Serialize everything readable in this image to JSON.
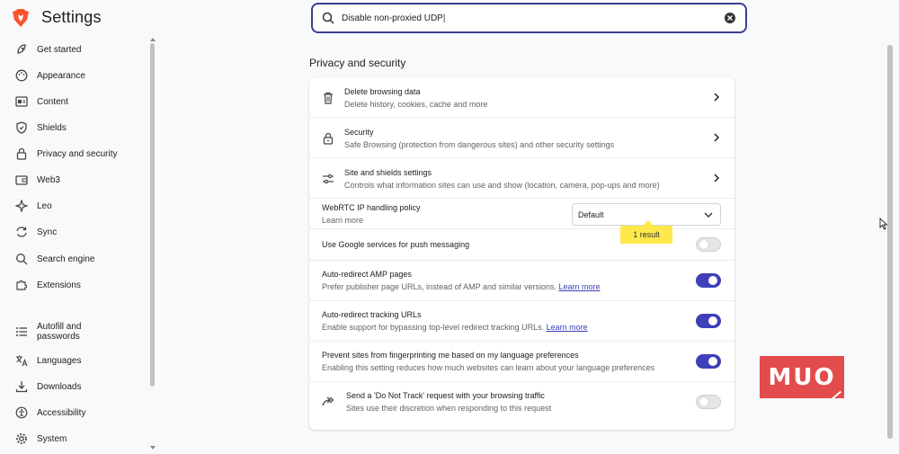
{
  "header": {
    "title": "Settings"
  },
  "search": {
    "value": "Disable non-proxied UDP"
  },
  "sidebar": {
    "items": [
      {
        "label": "Get started",
        "icon": "rocket-icon"
      },
      {
        "label": "Appearance",
        "icon": "palette-icon"
      },
      {
        "label": "Content",
        "icon": "content-icon"
      },
      {
        "label": "Shields",
        "icon": "shield-icon"
      },
      {
        "label": "Privacy and security",
        "icon": "lock-icon"
      },
      {
        "label": "Web3",
        "icon": "wallet-icon"
      },
      {
        "label": "Leo",
        "icon": "sparkle-icon"
      },
      {
        "label": "Sync",
        "icon": "sync-icon"
      },
      {
        "label": "Search engine",
        "icon": "search-icon"
      },
      {
        "label": "Extensions",
        "icon": "puzzle-icon"
      },
      {
        "label": "Autofill and passwords",
        "icon": "list-icon"
      },
      {
        "label": "Languages",
        "icon": "translate-icon"
      },
      {
        "label": "Downloads",
        "icon": "download-icon"
      },
      {
        "label": "Accessibility",
        "icon": "accessibility-icon"
      },
      {
        "label": "System",
        "icon": "gear-icon"
      }
    ]
  },
  "main": {
    "section_title": "Privacy and security",
    "rows": {
      "delete": {
        "title": "Delete browsing data",
        "subtitle": "Delete history, cookies, cache and more"
      },
      "security": {
        "title": "Security",
        "subtitle": "Safe Browsing (protection from dangerous sites) and other security settings"
      },
      "site_shields": {
        "title": "Site and shields settings",
        "subtitle": "Controls what information sites can use and show (location, camera, pop-ups and more)"
      },
      "webrtc": {
        "title": "WebRTC IP handling policy",
        "link": "Learn more",
        "select_value": "Default",
        "result_badge": "1 result"
      },
      "push": {
        "title": "Use Google services for push messaging",
        "enabled": false
      },
      "amp": {
        "title": "Auto-redirect AMP pages",
        "subtitle": "Prefer publisher page URLs, instead of AMP and similar versions.",
        "link": "Learn more",
        "enabled": true
      },
      "tracking": {
        "title": "Auto-redirect tracking URLs",
        "subtitle": "Enable support for bypassing top-level redirect tracking URLs.",
        "link": "Learn more",
        "enabled": true
      },
      "fingerprint": {
        "title": "Prevent sites from fingerprinting me based on my language preferences",
        "subtitle": "Enabling this setting reduces how much websites can learn about your language preferences",
        "enabled": true
      },
      "dnt": {
        "title": "Send a 'Do Not Track' request with your browsing traffic",
        "subtitle": "Sites use their discretion when responding to this request",
        "enabled": false
      }
    }
  },
  "watermark": {
    "text": "MUO"
  },
  "colors": {
    "accent": "#3f3fb8",
    "search_border": "#3b3e8f",
    "badge": "#ffe94a",
    "watermark": "#e24c4c"
  }
}
